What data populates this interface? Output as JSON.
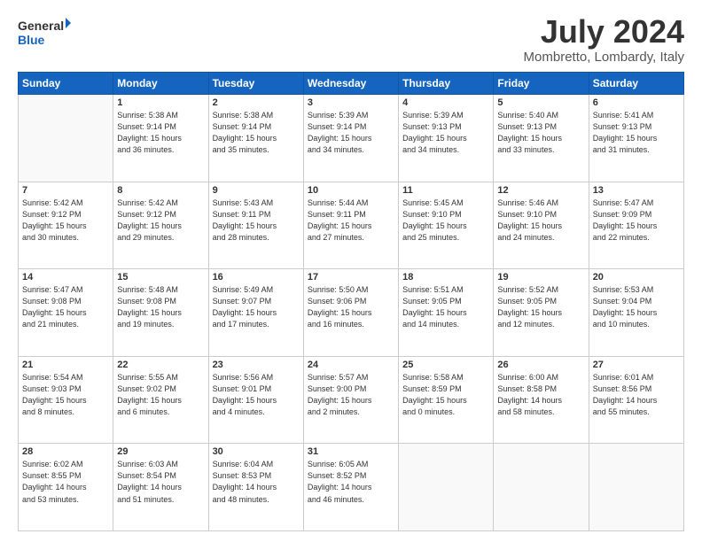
{
  "header": {
    "logo_line1": "General",
    "logo_line2": "Blue",
    "title": "July 2024",
    "subtitle": "Mombretto, Lombardy, Italy"
  },
  "calendar": {
    "headers": [
      "Sunday",
      "Monday",
      "Tuesday",
      "Wednesday",
      "Thursday",
      "Friday",
      "Saturday"
    ],
    "weeks": [
      [
        {
          "day": "",
          "info": ""
        },
        {
          "day": "1",
          "info": "Sunrise: 5:38 AM\nSunset: 9:14 PM\nDaylight: 15 hours\nand 36 minutes."
        },
        {
          "day": "2",
          "info": "Sunrise: 5:38 AM\nSunset: 9:14 PM\nDaylight: 15 hours\nand 35 minutes."
        },
        {
          "day": "3",
          "info": "Sunrise: 5:39 AM\nSunset: 9:14 PM\nDaylight: 15 hours\nand 34 minutes."
        },
        {
          "day": "4",
          "info": "Sunrise: 5:39 AM\nSunset: 9:13 PM\nDaylight: 15 hours\nand 34 minutes."
        },
        {
          "day": "5",
          "info": "Sunrise: 5:40 AM\nSunset: 9:13 PM\nDaylight: 15 hours\nand 33 minutes."
        },
        {
          "day": "6",
          "info": "Sunrise: 5:41 AM\nSunset: 9:13 PM\nDaylight: 15 hours\nand 31 minutes."
        }
      ],
      [
        {
          "day": "7",
          "info": "Sunrise: 5:42 AM\nSunset: 9:12 PM\nDaylight: 15 hours\nand 30 minutes."
        },
        {
          "day": "8",
          "info": "Sunrise: 5:42 AM\nSunset: 9:12 PM\nDaylight: 15 hours\nand 29 minutes."
        },
        {
          "day": "9",
          "info": "Sunrise: 5:43 AM\nSunset: 9:11 PM\nDaylight: 15 hours\nand 28 minutes."
        },
        {
          "day": "10",
          "info": "Sunrise: 5:44 AM\nSunset: 9:11 PM\nDaylight: 15 hours\nand 27 minutes."
        },
        {
          "day": "11",
          "info": "Sunrise: 5:45 AM\nSunset: 9:10 PM\nDaylight: 15 hours\nand 25 minutes."
        },
        {
          "day": "12",
          "info": "Sunrise: 5:46 AM\nSunset: 9:10 PM\nDaylight: 15 hours\nand 24 minutes."
        },
        {
          "day": "13",
          "info": "Sunrise: 5:47 AM\nSunset: 9:09 PM\nDaylight: 15 hours\nand 22 minutes."
        }
      ],
      [
        {
          "day": "14",
          "info": "Sunrise: 5:47 AM\nSunset: 9:08 PM\nDaylight: 15 hours\nand 21 minutes."
        },
        {
          "day": "15",
          "info": "Sunrise: 5:48 AM\nSunset: 9:08 PM\nDaylight: 15 hours\nand 19 minutes."
        },
        {
          "day": "16",
          "info": "Sunrise: 5:49 AM\nSunset: 9:07 PM\nDaylight: 15 hours\nand 17 minutes."
        },
        {
          "day": "17",
          "info": "Sunrise: 5:50 AM\nSunset: 9:06 PM\nDaylight: 15 hours\nand 16 minutes."
        },
        {
          "day": "18",
          "info": "Sunrise: 5:51 AM\nSunset: 9:05 PM\nDaylight: 15 hours\nand 14 minutes."
        },
        {
          "day": "19",
          "info": "Sunrise: 5:52 AM\nSunset: 9:05 PM\nDaylight: 15 hours\nand 12 minutes."
        },
        {
          "day": "20",
          "info": "Sunrise: 5:53 AM\nSunset: 9:04 PM\nDaylight: 15 hours\nand 10 minutes."
        }
      ],
      [
        {
          "day": "21",
          "info": "Sunrise: 5:54 AM\nSunset: 9:03 PM\nDaylight: 15 hours\nand 8 minutes."
        },
        {
          "day": "22",
          "info": "Sunrise: 5:55 AM\nSunset: 9:02 PM\nDaylight: 15 hours\nand 6 minutes."
        },
        {
          "day": "23",
          "info": "Sunrise: 5:56 AM\nSunset: 9:01 PM\nDaylight: 15 hours\nand 4 minutes."
        },
        {
          "day": "24",
          "info": "Sunrise: 5:57 AM\nSunset: 9:00 PM\nDaylight: 15 hours\nand 2 minutes."
        },
        {
          "day": "25",
          "info": "Sunrise: 5:58 AM\nSunset: 8:59 PM\nDaylight: 15 hours\nand 0 minutes."
        },
        {
          "day": "26",
          "info": "Sunrise: 6:00 AM\nSunset: 8:58 PM\nDaylight: 14 hours\nand 58 minutes."
        },
        {
          "day": "27",
          "info": "Sunrise: 6:01 AM\nSunset: 8:56 PM\nDaylight: 14 hours\nand 55 minutes."
        }
      ],
      [
        {
          "day": "28",
          "info": "Sunrise: 6:02 AM\nSunset: 8:55 PM\nDaylight: 14 hours\nand 53 minutes."
        },
        {
          "day": "29",
          "info": "Sunrise: 6:03 AM\nSunset: 8:54 PM\nDaylight: 14 hours\nand 51 minutes."
        },
        {
          "day": "30",
          "info": "Sunrise: 6:04 AM\nSunset: 8:53 PM\nDaylight: 14 hours\nand 48 minutes."
        },
        {
          "day": "31",
          "info": "Sunrise: 6:05 AM\nSunset: 8:52 PM\nDaylight: 14 hours\nand 46 minutes."
        },
        {
          "day": "",
          "info": ""
        },
        {
          "day": "",
          "info": ""
        },
        {
          "day": "",
          "info": ""
        }
      ]
    ]
  }
}
